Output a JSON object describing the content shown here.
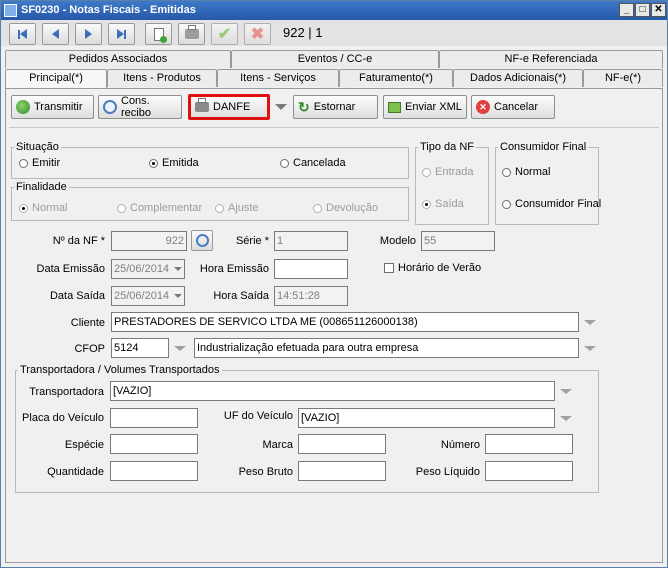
{
  "window": {
    "title": "SF0230 - Notas Fiscais - Emitidas"
  },
  "toolbar": {
    "counter": "922 | 1"
  },
  "tabs_top": [
    "Pedidos Associados",
    "Eventos / CC-e",
    "NF-e Referenciada"
  ],
  "tabs_bottom": [
    "Principal(*)",
    "Itens - Produtos",
    "Itens - Serviços",
    "Faturamento(*)",
    "Dados Adicionais(*)",
    "NF-e(*)"
  ],
  "actions": {
    "transmitir": "Transmitir",
    "cons_recibo": "Cons. recibo",
    "danfe": "DANFE",
    "estornar": "Estornar",
    "enviar_xml": "Enviar XML",
    "cancelar": "Cancelar"
  },
  "situacao": {
    "legend": "Situação",
    "options": [
      "Emitir",
      "Emitida",
      "Cancelada"
    ],
    "selected": "Emitida"
  },
  "finalidade": {
    "legend": "Finalidade",
    "options": [
      "Normal",
      "Complementar",
      "Ajuste",
      "Devolução"
    ],
    "selected": "Normal"
  },
  "tipo_nf": {
    "legend": "Tipo da NF",
    "options": [
      "Entrada",
      "Saída"
    ],
    "selected": "Saída"
  },
  "consumidor_final": {
    "legend": "Consumidor Final",
    "options": [
      "Normal",
      "Consumidor Final"
    ],
    "selected": ""
  },
  "form": {
    "num_nf_label": "Nº da NF *",
    "num_nf": "922",
    "serie_label": "Série *",
    "serie": "1",
    "modelo_label": "Modelo",
    "modelo": "55",
    "data_emissao_label": "Data Emissão",
    "data_emissao": "25/06/2014",
    "hora_emissao_label": "Hora Emissão",
    "hora_emissao": "",
    "horario_verao_label": "Horário de Verão",
    "data_saida_label": "Data Saída",
    "data_saida": "25/06/2014",
    "hora_saida_label": "Hora Saída",
    "hora_saida": "14:51:28",
    "cliente_label": "Cliente",
    "cliente": "PRESTADORES DE SERVICO LTDA ME (008651126000138)",
    "cfop_label": "CFOP",
    "cfop": "5124",
    "cfop_desc": "Industrialização efetuada para outra empresa"
  },
  "transporte": {
    "legend": "Transportadora / Volumes Transportados",
    "transportadora_label": "Transportadora",
    "transportadora": "[VAZIO]",
    "placa_label": "Placa do Veículo",
    "placa": "",
    "uf_label": "UF do Veículo",
    "uf": "[VAZIO]",
    "especie_label": "Espécie",
    "especie": "",
    "marca_label": "Marca",
    "marca": "",
    "numero_label": "Número",
    "numero": "",
    "quantidade_label": "Quantidade",
    "quantidade": "",
    "peso_bruto_label": "Peso Bruto",
    "peso_bruto": "",
    "peso_liquido_label": "Peso Líquido",
    "peso_liquido": ""
  },
  "colors": {
    "highlight": "#e01010",
    "title_bar": "#2f6bbf"
  }
}
